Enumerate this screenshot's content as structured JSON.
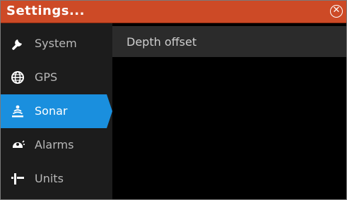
{
  "header": {
    "title": "Settings...",
    "close_icon": "close-icon"
  },
  "sidebar": {
    "items": [
      {
        "label": "System",
        "icon": "wrench-icon",
        "active": false
      },
      {
        "label": "GPS",
        "icon": "globe-icon",
        "active": false
      },
      {
        "label": "Sonar",
        "icon": "sonar-icon",
        "active": true
      },
      {
        "label": "Alarms",
        "icon": "alarm-icon",
        "active": false
      },
      {
        "label": "Units",
        "icon": "units-icon",
        "active": false
      }
    ]
  },
  "content": {
    "rows": [
      {
        "label": "Depth offset"
      }
    ]
  },
  "colors": {
    "titlebar": "#cd4a26",
    "active_item": "#1a8fde",
    "sidebar_bg": "#1c1c1c",
    "content_row_bg": "#2b2b2b"
  }
}
